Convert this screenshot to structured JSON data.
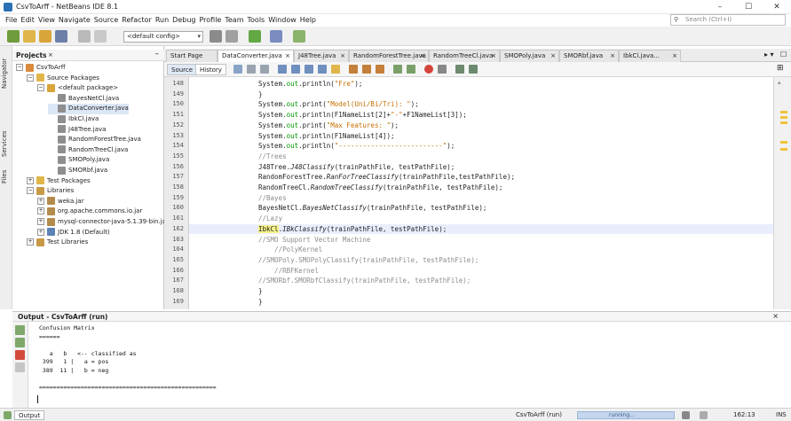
{
  "window": {
    "title": "CsvToArff - NetBeans IDE 8.1",
    "minimize": "–",
    "maximize": "☐",
    "close": "✕"
  },
  "menu": [
    "File",
    "Edit",
    "View",
    "Navigate",
    "Source",
    "Refactor",
    "Run",
    "Debug",
    "Profile",
    "Team",
    "Tools",
    "Window",
    "Help"
  ],
  "search": {
    "placeholder": "Search (Ctrl+I)"
  },
  "toolbar": {
    "config": "<default config>"
  },
  "leftstrip": {
    "navigator": "Navigator",
    "services": "Services",
    "files": "Files"
  },
  "projects": {
    "title": "Projects",
    "close": "×",
    "minimize": "–",
    "tree": [
      {
        "label": "CsvToArff",
        "indent": 0,
        "toggle": "−",
        "icon": "project-icon"
      },
      {
        "label": "Source Packages",
        "indent": 1,
        "toggle": "−",
        "icon": "package-folder-icon"
      },
      {
        "label": "<default package>",
        "indent": 2,
        "toggle": "−",
        "icon": "package-icon"
      },
      {
        "label": "BayesNetCl.java",
        "indent": 3,
        "toggle": "",
        "icon": "java-file-icon"
      },
      {
        "label": "DataConverter.java",
        "indent": 3,
        "toggle": "",
        "icon": "java-file-icon",
        "selected": true
      },
      {
        "label": "IbkCl.java",
        "indent": 3,
        "toggle": "",
        "icon": "java-file-icon"
      },
      {
        "label": "J48Tree.java",
        "indent": 3,
        "toggle": "",
        "icon": "java-file-icon"
      },
      {
        "label": "RandomForestTree.java",
        "indent": 3,
        "toggle": "",
        "icon": "java-file-icon"
      },
      {
        "label": "RandomTreeCl.java",
        "indent": 3,
        "toggle": "",
        "icon": "java-file-icon"
      },
      {
        "label": "SMOPoly.java",
        "indent": 3,
        "toggle": "",
        "icon": "java-file-icon"
      },
      {
        "label": "SMORbf.java",
        "indent": 3,
        "toggle": "",
        "icon": "java-file-icon"
      },
      {
        "label": "Test Packages",
        "indent": 1,
        "toggle": "+",
        "icon": "package-folder-icon"
      },
      {
        "label": "Libraries",
        "indent": 1,
        "toggle": "−",
        "icon": "library-folder-icon"
      },
      {
        "label": "weka.jar",
        "indent": 2,
        "toggle": "+",
        "icon": "jar-icon"
      },
      {
        "label": "org.apache.commons.io.jar",
        "indent": 2,
        "toggle": "+",
        "icon": "jar-icon"
      },
      {
        "label": "mysql-connector-java-5.1.39-bin.jar",
        "indent": 2,
        "toggle": "+",
        "icon": "jar-icon"
      },
      {
        "label": "JDK 1.8 (Default)",
        "indent": 2,
        "toggle": "+",
        "icon": "jdk-icon"
      },
      {
        "label": "Test Libraries",
        "indent": 1,
        "toggle": "+",
        "icon": "library-folder-icon"
      }
    ]
  },
  "editor": {
    "tabs": [
      {
        "label": "Start Page",
        "active": false
      },
      {
        "label": "DataConverter.java",
        "active": true
      },
      {
        "label": "J48Tree.java",
        "active": false
      },
      {
        "label": "RandomForestTree.java",
        "active": false
      },
      {
        "label": "RandomTreeCl.java",
        "active": false
      },
      {
        "label": "SMOPoly.java",
        "active": false
      },
      {
        "label": "SMORbf.java",
        "active": false
      },
      {
        "label": "IbkCl.java...",
        "active": false
      }
    ],
    "source_label": "Source",
    "history_label": "History",
    "current_line": 162,
    "lines": [
      {
        "n": "148",
        "segs": [
          {
            "t": "System.",
            "c": ""
          },
          {
            "t": "out",
            "c": "fld"
          },
          {
            "t": ".println(",
            "c": ""
          },
          {
            "t": "\"Fre\"",
            "c": "str"
          },
          {
            "t": ");",
            "c": ""
          }
        ]
      },
      {
        "n": "149",
        "segs": [
          {
            "t": "}",
            "c": ""
          }
        ]
      },
      {
        "n": "150",
        "segs": [
          {
            "t": "System.",
            "c": ""
          },
          {
            "t": "out",
            "c": "fld"
          },
          {
            "t": ".print(",
            "c": ""
          },
          {
            "t": "\"Model(Uni/Bi/Tri): \"",
            "c": "str"
          },
          {
            "t": ");",
            "c": ""
          }
        ]
      },
      {
        "n": "151",
        "segs": [
          {
            "t": "System.",
            "c": ""
          },
          {
            "t": "out",
            "c": "fld"
          },
          {
            "t": ".println(F1NameList[2]+",
            "c": ""
          },
          {
            "t": "\"-\"",
            "c": "str"
          },
          {
            "t": "+F1NameList[3]);",
            "c": ""
          }
        ]
      },
      {
        "n": "152",
        "segs": [
          {
            "t": "System.",
            "c": ""
          },
          {
            "t": "out",
            "c": "fld"
          },
          {
            "t": ".print(",
            "c": ""
          },
          {
            "t": "\"Max Features: \"",
            "c": "str"
          },
          {
            "t": ");",
            "c": ""
          }
        ]
      },
      {
        "n": "153",
        "segs": [
          {
            "t": "System.",
            "c": ""
          },
          {
            "t": "out",
            "c": "fld"
          },
          {
            "t": ".println(F1NameList[4]);",
            "c": ""
          }
        ]
      },
      {
        "n": "154",
        "segs": [
          {
            "t": "System.",
            "c": ""
          },
          {
            "t": "out",
            "c": "fld"
          },
          {
            "t": ".println(",
            "c": ""
          },
          {
            "t": "\"--------------------------\"",
            "c": "str"
          },
          {
            "t": ");",
            "c": ""
          }
        ]
      },
      {
        "n": "155",
        "segs": [
          {
            "t": "//Trees",
            "c": "cm"
          }
        ]
      },
      {
        "n": "156",
        "segs": [
          {
            "t": "J48Tree.",
            "c": ""
          },
          {
            "t": "J48Classify",
            "c": "it"
          },
          {
            "t": "(trainPathFile, testPathFile);",
            "c": ""
          }
        ]
      },
      {
        "n": "157",
        "segs": [
          {
            "t": "RandomForestTree.",
            "c": ""
          },
          {
            "t": "RanForTreeClassify",
            "c": "it"
          },
          {
            "t": "(trainPathFile,testPathFile);",
            "c": ""
          }
        ]
      },
      {
        "n": "158",
        "segs": [
          {
            "t": "RandomTreeCl.",
            "c": ""
          },
          {
            "t": "RandomTreeClassify",
            "c": "it"
          },
          {
            "t": "(trainPathFile, testPathFile);",
            "c": ""
          }
        ]
      },
      {
        "n": "159",
        "segs": [
          {
            "t": "//Bayes",
            "c": "cm"
          }
        ]
      },
      {
        "n": "160",
        "segs": [
          {
            "t": "BayesNetCl.",
            "c": ""
          },
          {
            "t": "BayesNetClassify",
            "c": "it"
          },
          {
            "t": "(trainPathFile, testPathFile);",
            "c": ""
          }
        ]
      },
      {
        "n": "161",
        "segs": [
          {
            "t": "//Lazy",
            "c": "cm"
          }
        ]
      },
      {
        "n": "162",
        "segs": [
          {
            "t": "IbkCl",
            "c": "hl"
          },
          {
            "t": ".",
            "c": ""
          },
          {
            "t": "IBkClassify",
            "c": "it"
          },
          {
            "t": "(trainPathFile, testPathFile);",
            "c": ""
          }
        ]
      },
      {
        "n": "163",
        "segs": [
          {
            "t": "//SMO Support Vector Machine",
            "c": "cm"
          }
        ]
      },
      {
        "n": "164",
        "segs": [
          {
            "t": "    //PolyKernel",
            "c": "cm"
          }
        ]
      },
      {
        "n": "165",
        "segs": [
          {
            "t": "//SMOPoly.SMOPolyClassify(trainPathFile, testPathFile);",
            "c": "cm"
          }
        ]
      },
      {
        "n": "166",
        "segs": [
          {
            "t": "    //RBFKernel",
            "c": "cm"
          }
        ]
      },
      {
        "n": "167",
        "segs": [
          {
            "t": "//SMORbf.SMORbfClassify(trainPathFile, testPathFile);",
            "c": "cm"
          }
        ]
      },
      {
        "n": "168",
        "segs": [
          {
            "t": "}",
            "c": ""
          }
        ]
      },
      {
        "n": "169",
        "segs": [
          {
            "t": "}",
            "c": ""
          }
        ]
      }
    ]
  },
  "output": {
    "title": "Output - CsvToArff (run)",
    "close": "×",
    "lines": [
      "Confusion Matrix",
      "======",
      "",
      "   a   b   <-- classified as",
      " 399   1 |   a = pos",
      " 389  11 |   b = neg",
      "",
      "==================================================="
    ]
  },
  "statusbar": {
    "output_tab": "Output",
    "process": "CsvToArff (run)",
    "progress_label": "running...",
    "position": "162:13",
    "insert_mode": "INS"
  }
}
